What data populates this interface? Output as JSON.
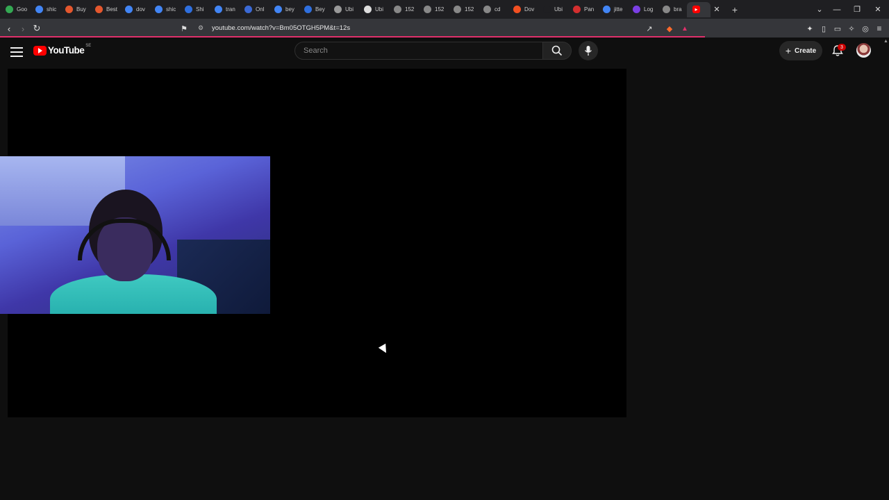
{
  "browser": {
    "tabs": [
      {
        "label": "Goo",
        "color": "#34a853"
      },
      {
        "label": "shic",
        "color": "#4285f4"
      },
      {
        "label": "Buy",
        "color": "#e4572e"
      },
      {
        "label": "Best",
        "color": "#e4572e"
      },
      {
        "label": "dov",
        "color": "#4285f4"
      },
      {
        "label": "shic",
        "color": "#4285f4"
      },
      {
        "label": "Shi",
        "color": "#2f6fde"
      },
      {
        "label": "tran",
        "color": "#4285f4"
      },
      {
        "label": "Onl",
        "color": "#3b6ad6"
      },
      {
        "label": "bey",
        "color": "#4285f4"
      },
      {
        "label": "Bey",
        "color": "#2f6fde"
      },
      {
        "label": "Ubi",
        "color": "#999999"
      },
      {
        "label": "Ubi",
        "color": "#dddddd"
      },
      {
        "label": "152",
        "color": "#888888"
      },
      {
        "label": "152",
        "color": "#888888"
      },
      {
        "label": "152",
        "color": "#888888"
      },
      {
        "label": "cd",
        "color": "#888888"
      },
      {
        "label": "Dov",
        "color": "#f25022"
      },
      {
        "label": "Ubi",
        "color": "#1f1f22"
      },
      {
        "label": "Pan",
        "color": "#d32f2f"
      },
      {
        "label": "jitte",
        "color": "#4285f4"
      },
      {
        "label": "Log",
        "color": "#7b3fe4"
      },
      {
        "label": "bra",
        "color": "#888888"
      }
    ],
    "active_tab_color": "#ff0000",
    "url": "youtube.com/watch?v=Bm05OTGH5PM&t=12s",
    "progress_color": "#e0306b"
  },
  "youtube": {
    "logo_text": "YouTube",
    "country_code": "SE",
    "search_placeholder": "Search",
    "create_label": "Create",
    "notification_count": "3"
  }
}
